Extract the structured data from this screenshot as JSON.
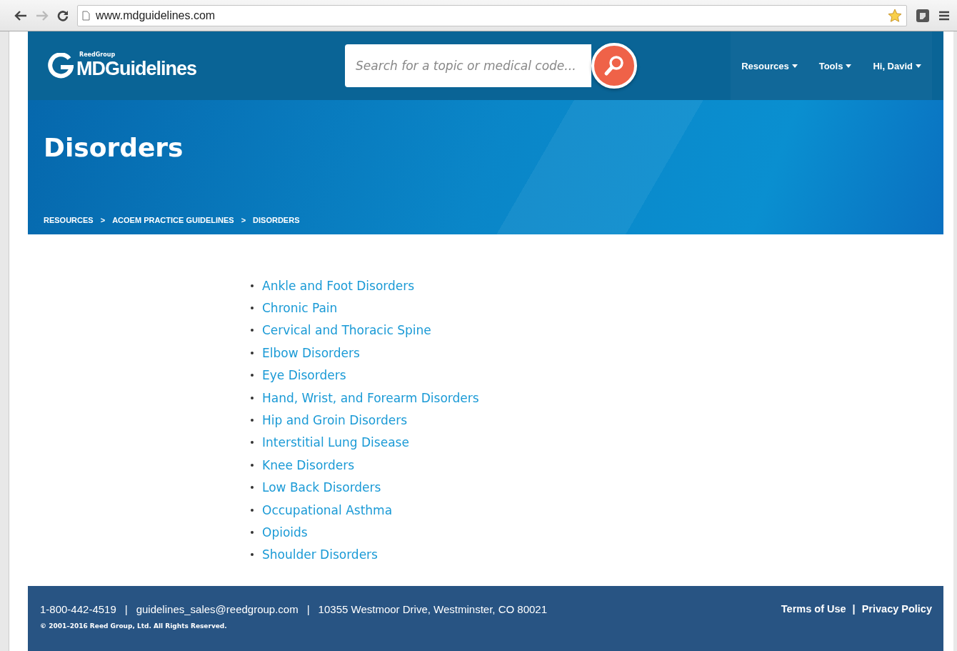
{
  "browser": {
    "url": "www.mdguidelines.com"
  },
  "header": {
    "logo_small": "ReedGroup",
    "logo": "MDGuidelines",
    "search": {
      "placeholder": "Search for a topic or medical code..."
    },
    "nav": [
      {
        "label": "Resources"
      },
      {
        "label": "Tools"
      },
      {
        "label": "Hi, David"
      }
    ]
  },
  "banner": {
    "title": "Disorders",
    "breadcrumb_separator": ">",
    "breadcrumbs": [
      "RESOURCES",
      "ACOEM PRACTICE GUIDELINES",
      "DISORDERS"
    ]
  },
  "links": [
    "Ankle and Foot Disorders",
    "Chronic Pain",
    "Cervical and Thoracic Spine",
    "Elbow Disorders",
    "Eye Disorders",
    "Hand, Wrist, and Forearm Disorders",
    "Hip and Groin Disorders",
    "Interstitial Lung Disease",
    "Knee Disorders",
    "Low Back Disorders",
    "Occupational Asthma",
    "Opioids",
    "Shoulder Disorders"
  ],
  "footer": {
    "separator": "|",
    "contact": [
      "1-800-442-4519",
      "guidelines_sales@reedgroup.com",
      "10355 Westmoor Drive, Westminster, CO 80021"
    ],
    "copyright": "© 2001–2016 Reed Group, Ltd. All Rights Reserved.",
    "links": [
      "Terms of Use",
      "Privacy Policy"
    ]
  }
}
